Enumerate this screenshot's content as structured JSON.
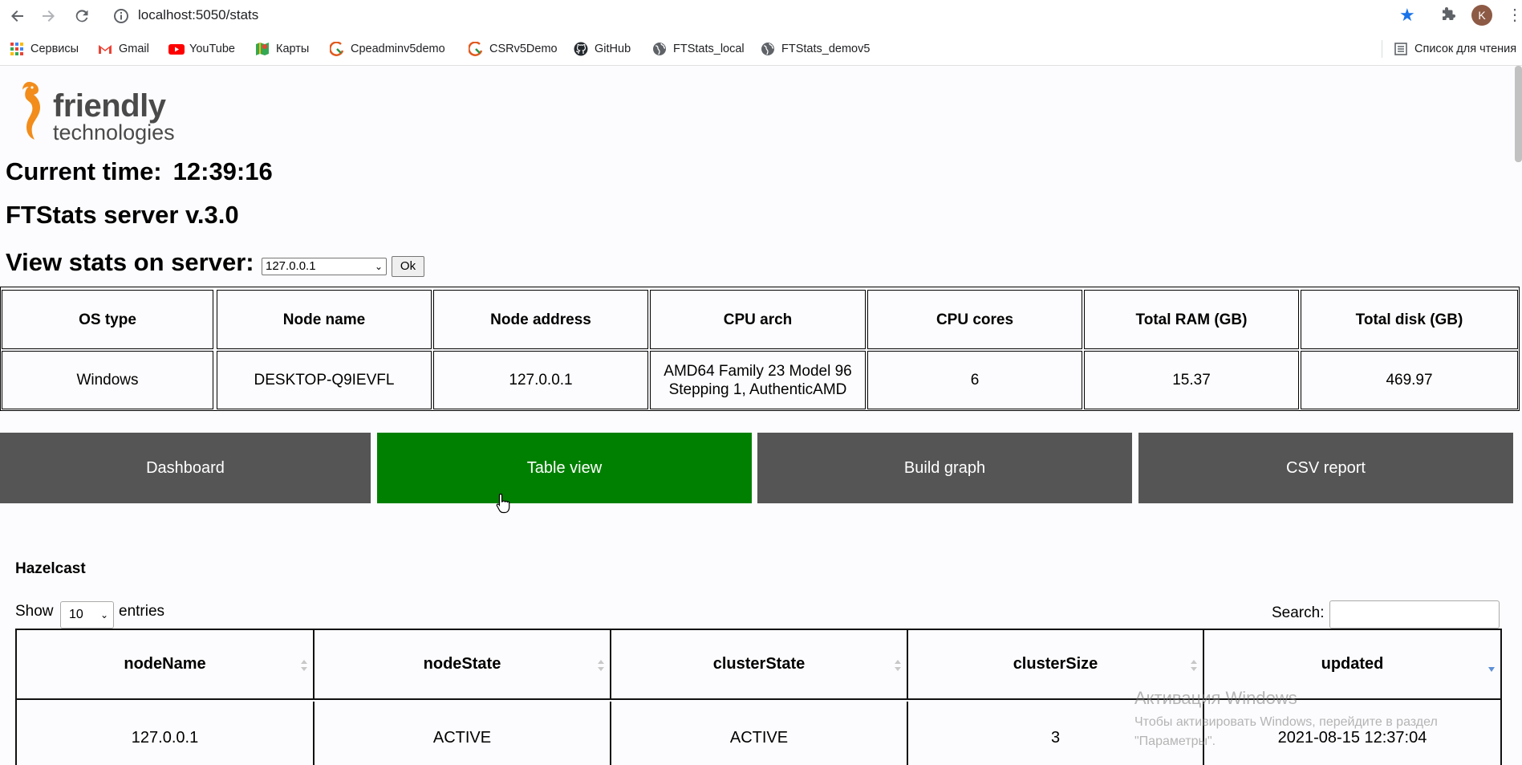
{
  "browser": {
    "url": "localhost:5050/stats",
    "bookmarks": [
      {
        "label": "Сервисы",
        "icon": "apps-grid-icon"
      },
      {
        "label": "Gmail",
        "icon": "gmail-icon"
      },
      {
        "label": "YouTube",
        "icon": "youtube-icon"
      },
      {
        "label": "Карты",
        "icon": "maps-icon"
      },
      {
        "label": "Cpeadminv5demo",
        "icon": "site-icon"
      },
      {
        "label": "CSRv5Demo",
        "icon": "site-icon"
      },
      {
        "label": "GitHub",
        "icon": "github-icon"
      },
      {
        "label": "FTStats_local",
        "icon": "globe-icon"
      },
      {
        "label": "FTStats_demov5",
        "icon": "globe-icon"
      }
    ],
    "reading_list": "Список для чтения",
    "profile_initial": "K",
    "accent_color": "#1a73e8"
  },
  "logo": {
    "word1": "friendly",
    "word2": "technologies",
    "accent_color": "#f28c1b"
  },
  "header": {
    "time_label": "Current time:",
    "time_value": "12:39:16",
    "version": "FTStats server v.3.0",
    "view_label": "View stats on server:",
    "server_select": "127.0.0.1",
    "ok_label": "Ok"
  },
  "info_table": {
    "headers": [
      "OS type",
      "Node name",
      "Node address",
      "CPU arch",
      "CPU cores",
      "Total RAM (GB)",
      "Total disk (GB)"
    ],
    "row": [
      "Windows",
      "DESKTOP-Q9IEVFL",
      "127.0.0.1",
      "AMD64 Family 23 Model 96 Stepping 1, AuthenticAMD",
      "6",
      "15.37",
      "469.97"
    ]
  },
  "tabs": [
    {
      "label": "Dashboard",
      "active": false
    },
    {
      "label": "Table view",
      "active": true
    },
    {
      "label": "Build graph",
      "active": false
    },
    {
      "label": "CSV report",
      "active": false
    }
  ],
  "colors": {
    "tab": "#555555",
    "tab_active": "#008000"
  },
  "section": {
    "title": "Hazelcast",
    "show_label": "Show",
    "entries_value": "10",
    "entries_label": "entries",
    "search_label": "Search:"
  },
  "data_table": {
    "headers": [
      "nodeName",
      "nodeState",
      "clusterState",
      "clusterSize",
      "updated"
    ],
    "rows": [
      [
        "127.0.0.1",
        "ACTIVE",
        "ACTIVE",
        "3",
        "2021-08-15 12:37:04"
      ]
    ]
  },
  "watermark": {
    "title": "Активация Windows",
    "text": "Чтобы активировать Windows, перейдите в раздел \"Параметры\"."
  }
}
